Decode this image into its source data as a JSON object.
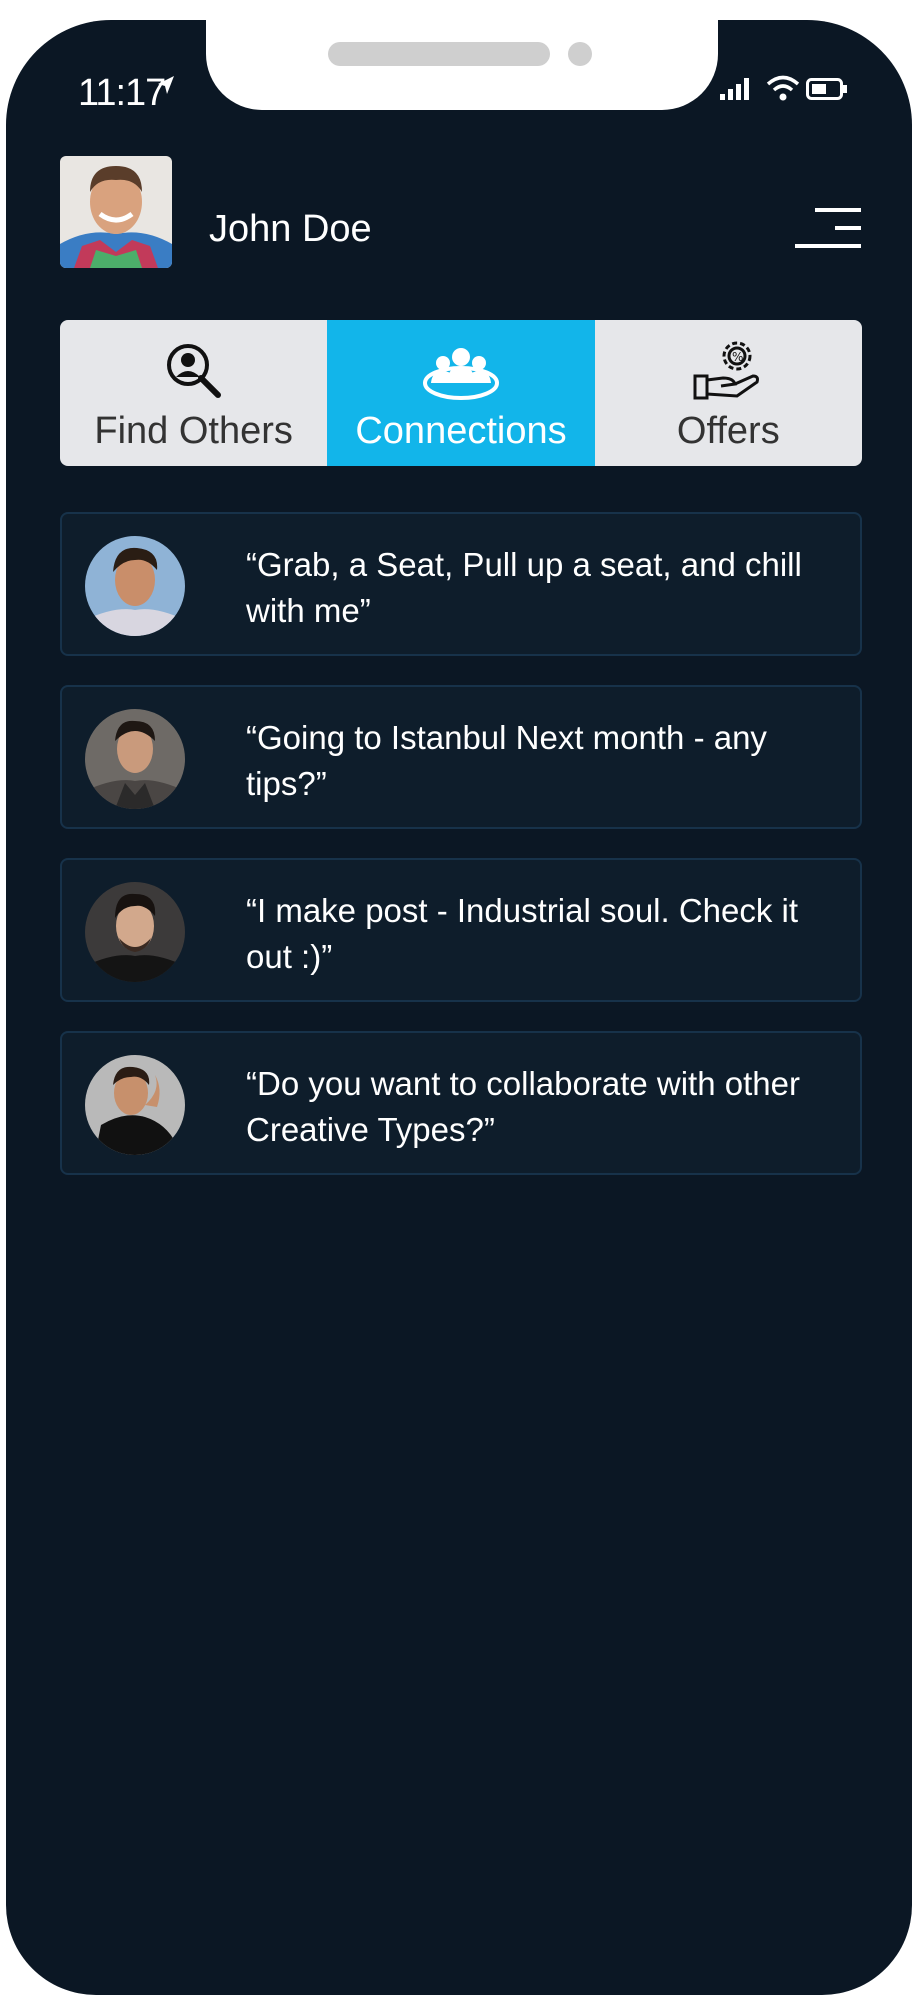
{
  "status_bar": {
    "time": "11:17",
    "icons": [
      "location-arrow-icon",
      "signal-icon",
      "wifi-icon",
      "battery-icon"
    ]
  },
  "header": {
    "user_name": "John Doe",
    "menu_icon": "menu-icon"
  },
  "tabs": [
    {
      "label": "Find Others",
      "icon": "search-person-icon",
      "active": false
    },
    {
      "label": "Connections",
      "icon": "group-icon",
      "active": true
    },
    {
      "label": "Offers",
      "icon": "hand-gear-icon",
      "active": false
    }
  ],
  "connections": [
    {
      "message": "“Grab, a Seat, Pull up a seat, and chill with me”"
    },
    {
      "message": "“Going to Istanbul Next month - any tips?”"
    },
    {
      "message": "“I make post - Industrial soul. Check it out :)”"
    },
    {
      "message": "“Do you want to collaborate with other Creative Types?”"
    }
  ],
  "colors": {
    "background": "#0b1724",
    "card": "#0e1d2b",
    "accent": "#12b5ea",
    "tab_inactive": "#e6e7ea"
  }
}
